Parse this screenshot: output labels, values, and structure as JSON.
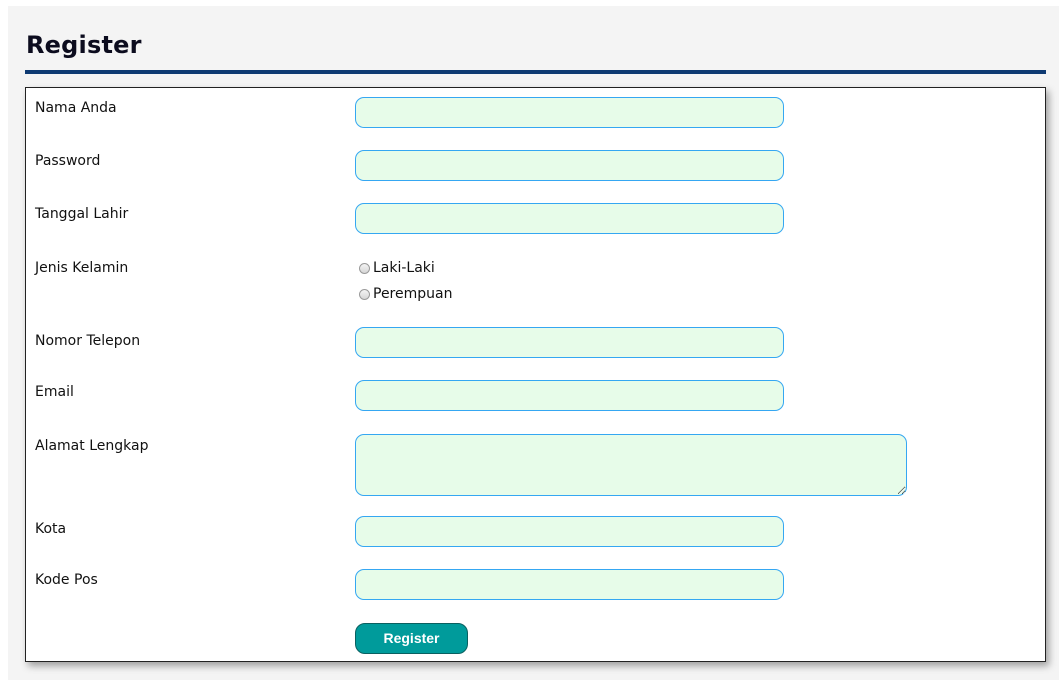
{
  "page": {
    "title": "Register"
  },
  "form": {
    "fields": {
      "nama_anda": {
        "label": "Nama Anda",
        "value": ""
      },
      "password": {
        "label": "Password",
        "value": ""
      },
      "tanggal_lahir": {
        "label": "Tanggal Lahir",
        "value": ""
      },
      "jenis_kelamin": {
        "label": "Jenis Kelamin",
        "options": [
          "Laki-Laki",
          "Perempuan"
        ],
        "selected": null
      },
      "nomor_telepon": {
        "label": "Nomor Telepon",
        "value": ""
      },
      "email": {
        "label": "Email",
        "value": ""
      },
      "alamat_lengkap": {
        "label": "Alamat Lengkap",
        "value": ""
      },
      "kota": {
        "label": "Kota",
        "value": ""
      },
      "kode_pos": {
        "label": "Kode Pos",
        "value": ""
      }
    },
    "submit_label": "Register"
  },
  "colors": {
    "input_bg": "#e7fce9",
    "input_border": "#35a7f2",
    "title_rule": "#0e3a72",
    "button_bg": "#009b9b"
  }
}
